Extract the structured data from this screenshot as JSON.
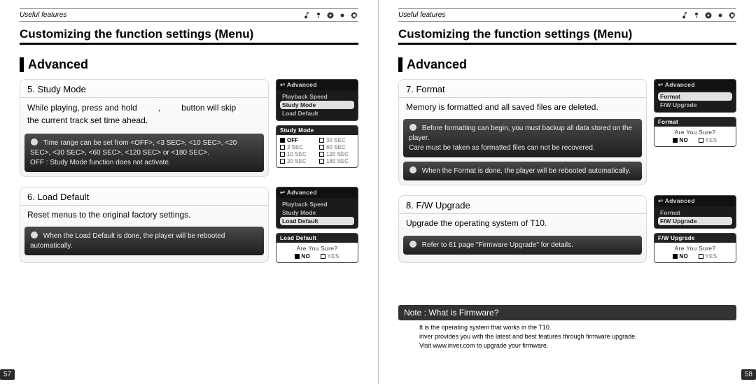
{
  "left": {
    "header": "Useful features",
    "title": "Customizing the function settings (Menu)",
    "section": "Advanced",
    "card1": {
      "title": "5. Study Mode",
      "line1a": "While playing, press and hold",
      "line1b": ",",
      "line1c": "button will skip",
      "line2": "the current track set time ahead.",
      "note1": "Time range can be set from <OFF>, <3 SEC>, <10 SEC>, <20 SEC>, <30 SEC>, <60 SEC>, <120 SEC> or <180 SEC>.",
      "note2": "OFF : Study Mode function does not activate."
    },
    "card1_lcd": {
      "head": "Advanced",
      "items": [
        "Playback Speed",
        "Study Mode",
        "Load Default"
      ],
      "sel_index": 1,
      "panel_title": "Study Mode",
      "grid": [
        "OFF",
        "30 SEC",
        "3 SEC",
        "60 SEC",
        "10 SEC",
        "120 SEC",
        "20 SEC",
        "180 SEC"
      ],
      "grid_checked_index": 0
    },
    "card2": {
      "title": "6. Load Default",
      "text": "Reset menus to the original factory settings.",
      "note": "When the Load Default is done, the player will be rebooted automatically."
    },
    "card2_lcd": {
      "head": "Advanced",
      "items": [
        "Playback Speed",
        "Study Mode",
        "Load Default"
      ],
      "sel_index": 2,
      "panel_title": "Load Default",
      "q": "Are You Sure?",
      "no": "NO",
      "yes": "YES"
    },
    "page_num": "57"
  },
  "right": {
    "header": "Useful features",
    "title": "Customizing the function settings (Menu)",
    "section": "Advanced",
    "card1": {
      "title": "7. Format",
      "line1": "Memory is formatted and all saved files are deleted.",
      "note1a": "Before formatting can begin, you must backup all data stored on the player.",
      "note1b": "Care must be taken as formatted files can not be recovered.",
      "note2": "When the Format is done, the player will be rebooted automatically."
    },
    "card1_lcd": {
      "head": "Advanced",
      "items": [
        "Format",
        "F/W Upgrade"
      ],
      "sel_index": 0,
      "panel_title": "Format",
      "q": "Are You Sure?",
      "no": "NO",
      "yes": "YES"
    },
    "card2": {
      "title": "8. F/W Upgrade",
      "text": "Upgrade the operating system of T10.",
      "note": "Refer to 61 page \"Firmware Upgrade\" for details."
    },
    "card2_lcd": {
      "head": "Advanced",
      "items": [
        "Format",
        "F/W Upgrade"
      ],
      "sel_index": 1,
      "panel_title": "F/W Upgrade",
      "q": "Are You Sure?",
      "no": "NO",
      "yes": "YES"
    },
    "firmware": {
      "heading": "Note : What is Firmware?",
      "l1": "It is the operating system that works in the T10.",
      "l2": "iriver provides you with the latest and best features through firmware upgrade.",
      "l3": "Visit www.iriver.com to upgrade your firmware."
    },
    "page_num": "58"
  }
}
